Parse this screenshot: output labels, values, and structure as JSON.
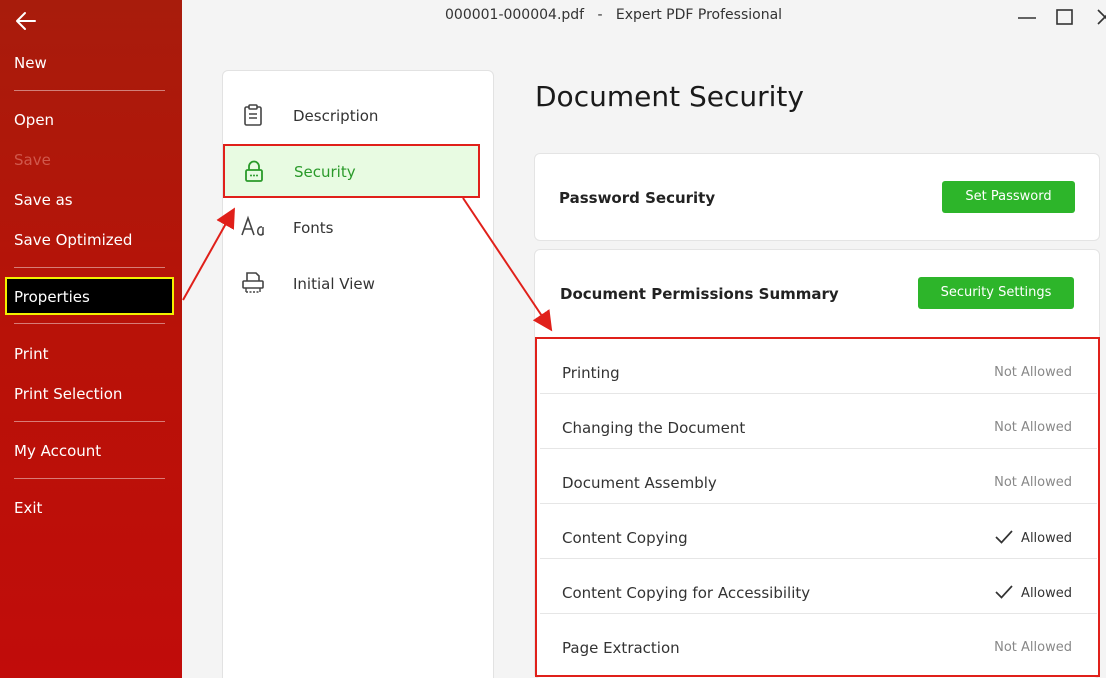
{
  "window": {
    "title": "000001-000004.pdf   -   Expert PDF Professional"
  },
  "sidebar": {
    "items": [
      {
        "label": "New"
      },
      {
        "label": "Open"
      },
      {
        "label": "Save"
      },
      {
        "label": "Save as"
      },
      {
        "label": "Save Optimized"
      },
      {
        "label": "Properties"
      },
      {
        "label": "Print"
      },
      {
        "label": "Print Selection"
      },
      {
        "label": "My Account"
      },
      {
        "label": "Exit"
      }
    ]
  },
  "categories": [
    {
      "label": "Description",
      "icon": "clipboard-icon"
    },
    {
      "label": "Security",
      "icon": "lock-icon"
    },
    {
      "label": "Fonts",
      "icon": "font-icon"
    },
    {
      "label": "Initial View",
      "icon": "printer-icon"
    }
  ],
  "main": {
    "title": "Document Security",
    "password_card": {
      "title": "Password Security",
      "button": "Set Password"
    },
    "permissions_card": {
      "title": "Document Permissions Summary",
      "button": "Security Settings"
    },
    "permissions": [
      {
        "name": "Printing",
        "status": "Not Allowed",
        "allowed": false
      },
      {
        "name": "Changing the Document",
        "status": "Not Allowed",
        "allowed": false
      },
      {
        "name": "Document Assembly",
        "status": "Not Allowed",
        "allowed": false
      },
      {
        "name": "Content Copying",
        "status": "Allowed",
        "allowed": true
      },
      {
        "name": "Content Copying for Accessibility",
        "status": "Allowed",
        "allowed": true
      },
      {
        "name": "Page Extraction",
        "status": "Not Allowed",
        "allowed": false
      }
    ]
  },
  "colors": {
    "sidebar": "#b81208",
    "accent_green": "#2db52a",
    "highlight_red": "#e0201a",
    "highlight_yellow": "#f2f000"
  }
}
